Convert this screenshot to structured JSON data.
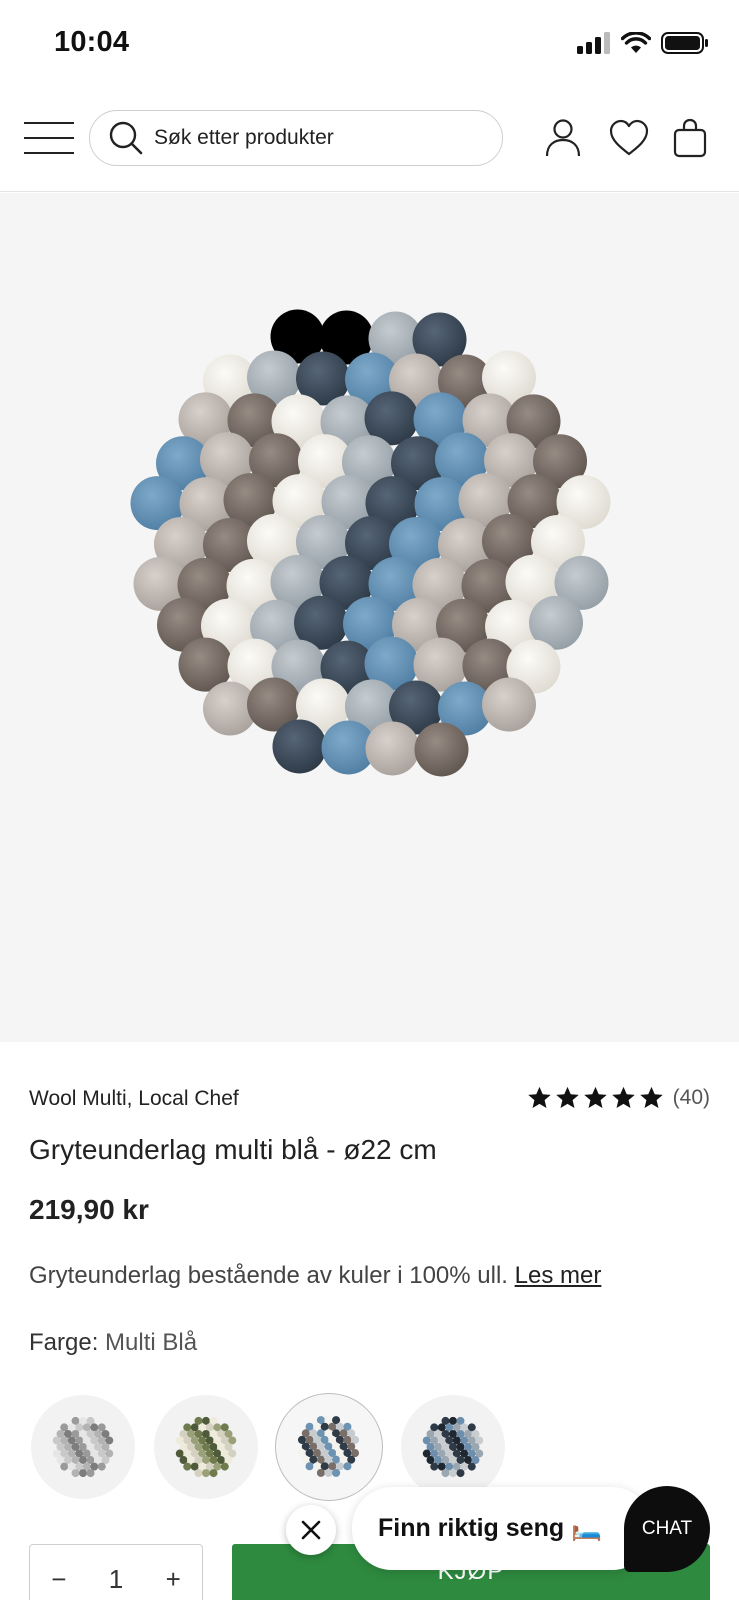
{
  "status_bar": {
    "time": "10:04"
  },
  "header": {
    "search_placeholder": "Søk etter produkter",
    "icons": [
      "menu-icon",
      "search-icon",
      "account-icon",
      "wishlist-heart-icon",
      "cart-bag-icon"
    ]
  },
  "product": {
    "brand": "Wool Multi, Local Chef",
    "rating_stars": 5,
    "rating_count": "(40)",
    "title": "Gryteunderlag multi blå - ø22 cm",
    "price": "219,90 kr",
    "description": "Gryteunderlag bestående av kuler i 100% ull.",
    "read_more": "Les mer",
    "color_label": "Farge:",
    "color_value": "Multi Blå",
    "swatches": [
      "Grå multi",
      "Grønn multi",
      "Multi Blå",
      "Mørk multi"
    ],
    "selected_swatch_index": 2
  },
  "purchase": {
    "quantity": "1",
    "minus": "−",
    "plus": "+",
    "buy_label": "KJØP"
  },
  "chat": {
    "promo_text": "Finn riktig seng 🛏️",
    "button_label": "CHAT"
  },
  "colors": {
    "buy_green": "#2e8a3f",
    "hero_bg": "#f5f5f5",
    "chat_black": "#0d0d0d"
  }
}
